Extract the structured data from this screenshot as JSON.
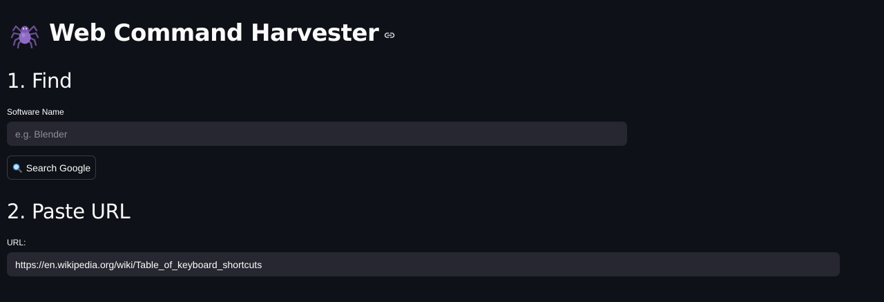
{
  "app": {
    "title": "Web Command Harvester",
    "title_icon": "spider-icon",
    "anchor_icon": "link-icon"
  },
  "find_section": {
    "heading": "1. Find",
    "software_name_label": "Software Name",
    "software_name_placeholder": "e.g. Blender",
    "software_name_value": "",
    "search_button_label": "Search Google",
    "search_button_icon": "magnifier-icon"
  },
  "paste_section": {
    "heading": "2. Paste URL",
    "url_label": "URL:",
    "url_value": "https://en.wikipedia.org/wiki/Table_of_keyboard_shortcuts"
  },
  "colors": {
    "background": "#0e1117",
    "input_background": "#262730",
    "text": "#fafafa",
    "placeholder": "#8b8d97",
    "button_border": "#3a3c46"
  }
}
